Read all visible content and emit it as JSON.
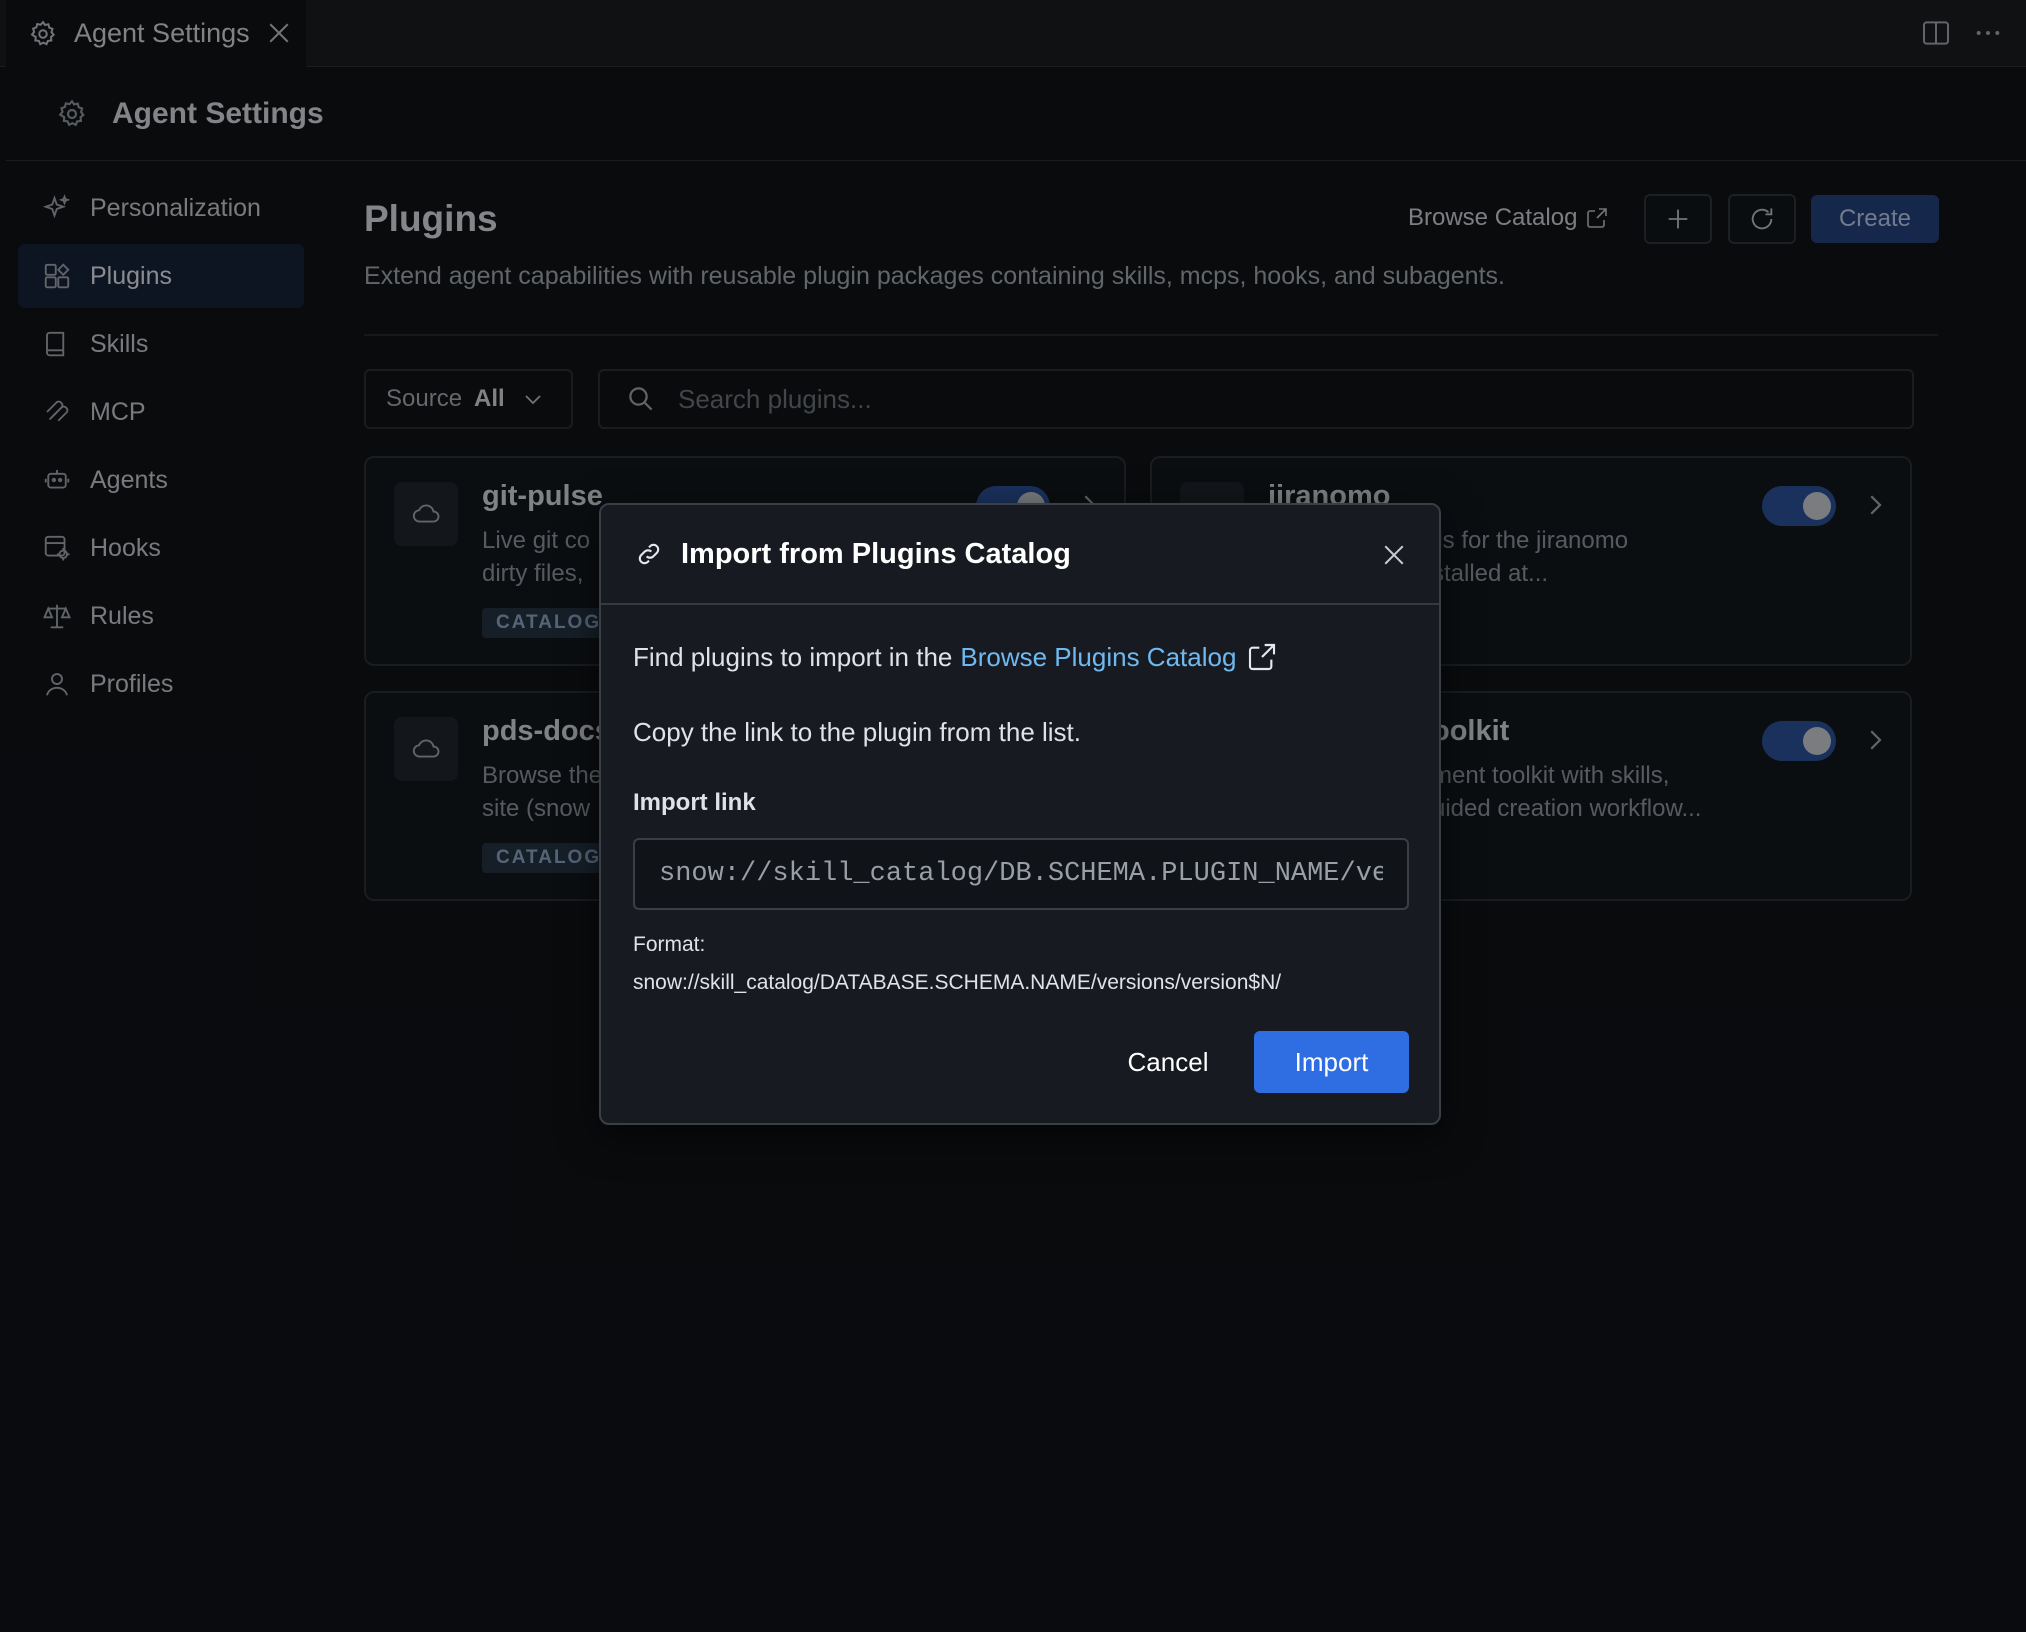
{
  "tab": {
    "title": "Agent Settings"
  },
  "header": {
    "title": "Agent Settings"
  },
  "sidebar": {
    "items": [
      {
        "label": "Personalization",
        "icon": "sparkle-icon"
      },
      {
        "label": "Plugins",
        "icon": "plugin-icon",
        "active": true
      },
      {
        "label": "Skills",
        "icon": "book-icon"
      },
      {
        "label": "MCP",
        "icon": "mcp-icon"
      },
      {
        "label": "Agents",
        "icon": "robot-icon"
      },
      {
        "label": "Hooks",
        "icon": "hook-icon"
      },
      {
        "label": "Rules",
        "icon": "scale-icon"
      },
      {
        "label": "Profiles",
        "icon": "user-icon"
      }
    ]
  },
  "main": {
    "title": "Plugins",
    "description": "Extend agent capabilities with reusable plugin packages containing skills, mcps, hooks, and subagents.",
    "browse_label": "Browse Catalog",
    "create_label": "Create",
    "source_label": "Source",
    "source_value": "All",
    "search_placeholder": "Search plugins...",
    "cards": [
      {
        "name": "git-pulse",
        "desc_line1": "Live git co",
        "desc_line2": "dirty files,",
        "badge": "CATALOG",
        "enabled": true
      },
      {
        "name": "jiranomo",
        "desc_line1": "lls for the jiranomo",
        "desc_line2": "stalled at...",
        "enabled": true
      },
      {
        "name": "pds-docs",
        "desc_line1": "Browse the",
        "desc_line2": "site (snow",
        "badge": "CATALOG",
        "enabled": true
      },
      {
        "name": "oolkit",
        "desc_line1": "ment toolkit with skills,",
        "desc_line2": "uided creation workflow...",
        "enabled": true
      }
    ]
  },
  "modal": {
    "title": "Import from Plugins Catalog",
    "find_text": "Find plugins to import in the",
    "catalog_link": "Browse Plugins Catalog",
    "copy_text": "Copy the link to the plugin from the list.",
    "import_label": "Import link",
    "import_placeholder": "snow://skill_catalog/DB.SCHEMA.PLUGIN_NAME/versions/version$N/",
    "format_label": "Format:",
    "format_value": "snow://skill_catalog/DATABASE.SCHEMA.NAME/versions/version$N/",
    "cancel_label": "Cancel",
    "import_button": "Import"
  },
  "colors": {
    "background": "#0f1216",
    "accent": "#2f6de3",
    "link": "#70b9f0",
    "toggle_on": "#2d4f96"
  }
}
